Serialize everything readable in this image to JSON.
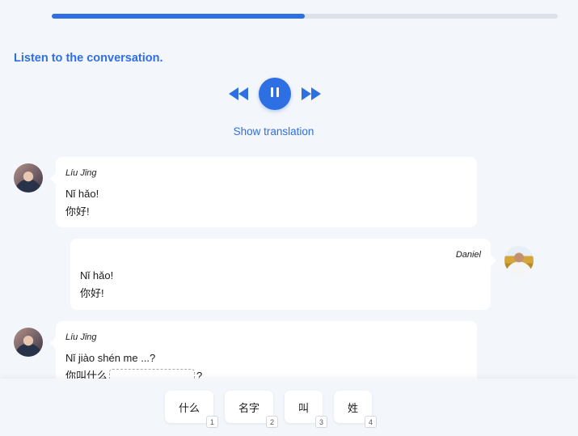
{
  "progress": 0.5,
  "colors": {
    "accent": "#2f6fe4"
  },
  "instruction": "Listen to the conversation.",
  "controls": {
    "rewind_icon": "rewind-icon",
    "pause_icon": "pause-icon",
    "forward_icon": "fast-forward-icon"
  },
  "show_translation": "Show translation",
  "messages": [
    {
      "speaker": "Líu Jīng",
      "pinyin": "Nǐ hǎo!",
      "hanzi": "你好!"
    },
    {
      "speaker": "Daniel",
      "pinyin": "Nǐ hǎo!",
      "hanzi": "你好!"
    },
    {
      "speaker": "Líu Jīng",
      "pinyin": "Nǐ jiào shén me ...?",
      "hanzi_before": "你叫什么",
      "hanzi_after": "?"
    }
  ],
  "options": [
    {
      "label": "什么",
      "key": "1"
    },
    {
      "label": "名字",
      "key": "2"
    },
    {
      "label": "叫",
      "key": "3"
    },
    {
      "label": "姓",
      "key": "4"
    }
  ]
}
